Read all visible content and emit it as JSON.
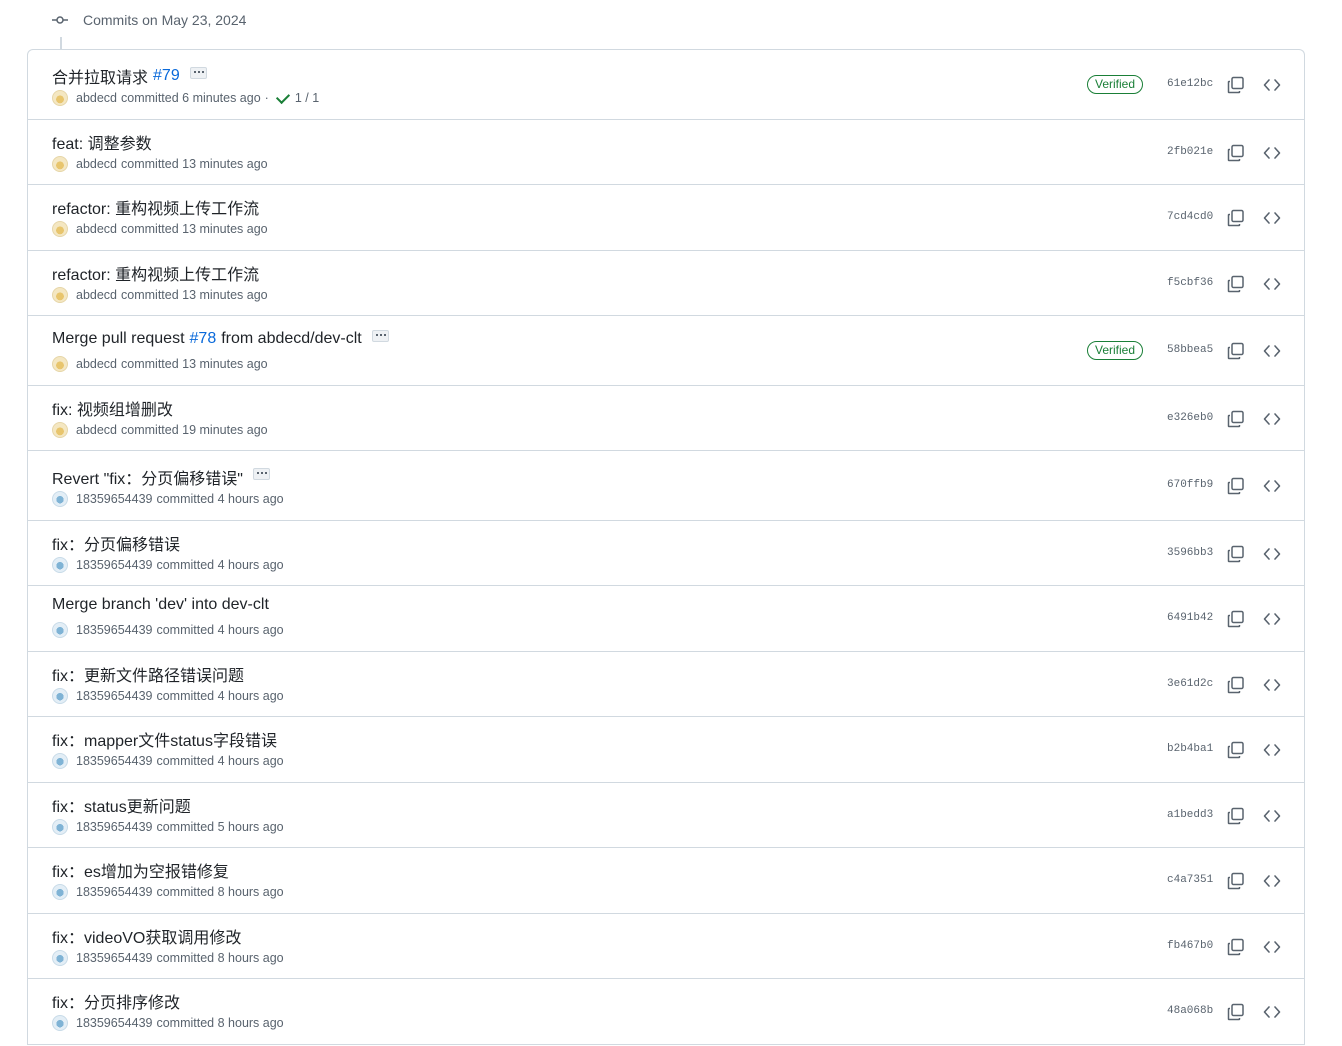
{
  "group": {
    "title": "Commits on May 23, 2024",
    "icon": "git-commit-icon"
  },
  "colors": {
    "verified": "#1a7f37",
    "link": "#0969da",
    "muted": "#59636e",
    "border": "#d1d9e0"
  },
  "commits": [
    {
      "message": "合并拉取请求",
      "pr": "#79",
      "after": "",
      "more": true,
      "author": "abdecd",
      "time": "committed 6 minutes ago",
      "checks": "1 / 1",
      "verified": "Verified",
      "sha": "61e12bc",
      "avatar": "a1"
    },
    {
      "message": "feat: 调整参数",
      "pr": "",
      "after": "",
      "more": false,
      "author": "abdecd",
      "time": "committed 13 minutes ago",
      "checks": "",
      "verified": "",
      "sha": "2fb021e",
      "avatar": "a1"
    },
    {
      "message": "refactor: 重构视频上传工作流",
      "pr": "",
      "after": "",
      "more": false,
      "author": "abdecd",
      "time": "committed 13 minutes ago",
      "checks": "",
      "verified": "",
      "sha": "7cd4cd0",
      "avatar": "a1"
    },
    {
      "message": "refactor: 重构视频上传工作流",
      "pr": "",
      "after": "",
      "more": false,
      "author": "abdecd",
      "time": "committed 13 minutes ago",
      "checks": "",
      "verified": "",
      "sha": "f5cbf36",
      "avatar": "a1"
    },
    {
      "message": "Merge pull request",
      "pr": "#78",
      "after": "from abdecd/dev-clt",
      "more": true,
      "author": "abdecd",
      "time": "committed 13 minutes ago",
      "checks": "",
      "verified": "Verified",
      "sha": "58bbea5",
      "avatar": "a1"
    },
    {
      "message": "fix: 视频组增删改",
      "pr": "",
      "after": "",
      "more": false,
      "author": "abdecd",
      "time": "committed 19 minutes ago",
      "checks": "",
      "verified": "",
      "sha": "e326eb0",
      "avatar": "a1"
    },
    {
      "message": "Revert \"fix：分页偏移错误\"",
      "pr": "",
      "after": "",
      "more": true,
      "author": "18359654439",
      "time": "committed 4 hours ago",
      "checks": "",
      "verified": "",
      "sha": "670ffb9",
      "avatar": "a2"
    },
    {
      "message": "fix：分页偏移错误",
      "pr": "",
      "after": "",
      "more": false,
      "author": "18359654439",
      "time": "committed 4 hours ago",
      "checks": "",
      "verified": "",
      "sha": "3596bb3",
      "avatar": "a2"
    },
    {
      "message": "Merge branch 'dev' into dev-clt",
      "pr": "",
      "after": "",
      "more": false,
      "author": "18359654439",
      "time": "committed 4 hours ago",
      "checks": "",
      "verified": "",
      "sha": "6491b42",
      "avatar": "a2"
    },
    {
      "message": "fix：更新文件路径错误问题",
      "pr": "",
      "after": "",
      "more": false,
      "author": "18359654439",
      "time": "committed 4 hours ago",
      "checks": "",
      "verified": "",
      "sha": "3e61d2c",
      "avatar": "a2"
    },
    {
      "message": "fix：mapper文件status字段错误",
      "pr": "",
      "after": "",
      "more": false,
      "author": "18359654439",
      "time": "committed 4 hours ago",
      "checks": "",
      "verified": "",
      "sha": "b2b4ba1",
      "avatar": "a2"
    },
    {
      "message": "fix：status更新问题",
      "pr": "",
      "after": "",
      "more": false,
      "author": "18359654439",
      "time": "committed 5 hours ago",
      "checks": "",
      "verified": "",
      "sha": "a1bedd3",
      "avatar": "a2"
    },
    {
      "message": "fix：es增加为空报错修复",
      "pr": "",
      "after": "",
      "more": false,
      "author": "18359654439",
      "time": "committed 8 hours ago",
      "checks": "",
      "verified": "",
      "sha": "c4a7351",
      "avatar": "a2"
    },
    {
      "message": "fix：videoVO获取调用修改",
      "pr": "",
      "after": "",
      "more": false,
      "author": "18359654439",
      "time": "committed 8 hours ago",
      "checks": "",
      "verified": "",
      "sha": "fb467b0",
      "avatar": "a2"
    },
    {
      "message": "fix：分页排序修改",
      "pr": "",
      "after": "",
      "more": false,
      "author": "18359654439",
      "time": "committed 8 hours ago",
      "checks": "",
      "verified": "",
      "sha": "48a068b",
      "avatar": "a2"
    }
  ]
}
